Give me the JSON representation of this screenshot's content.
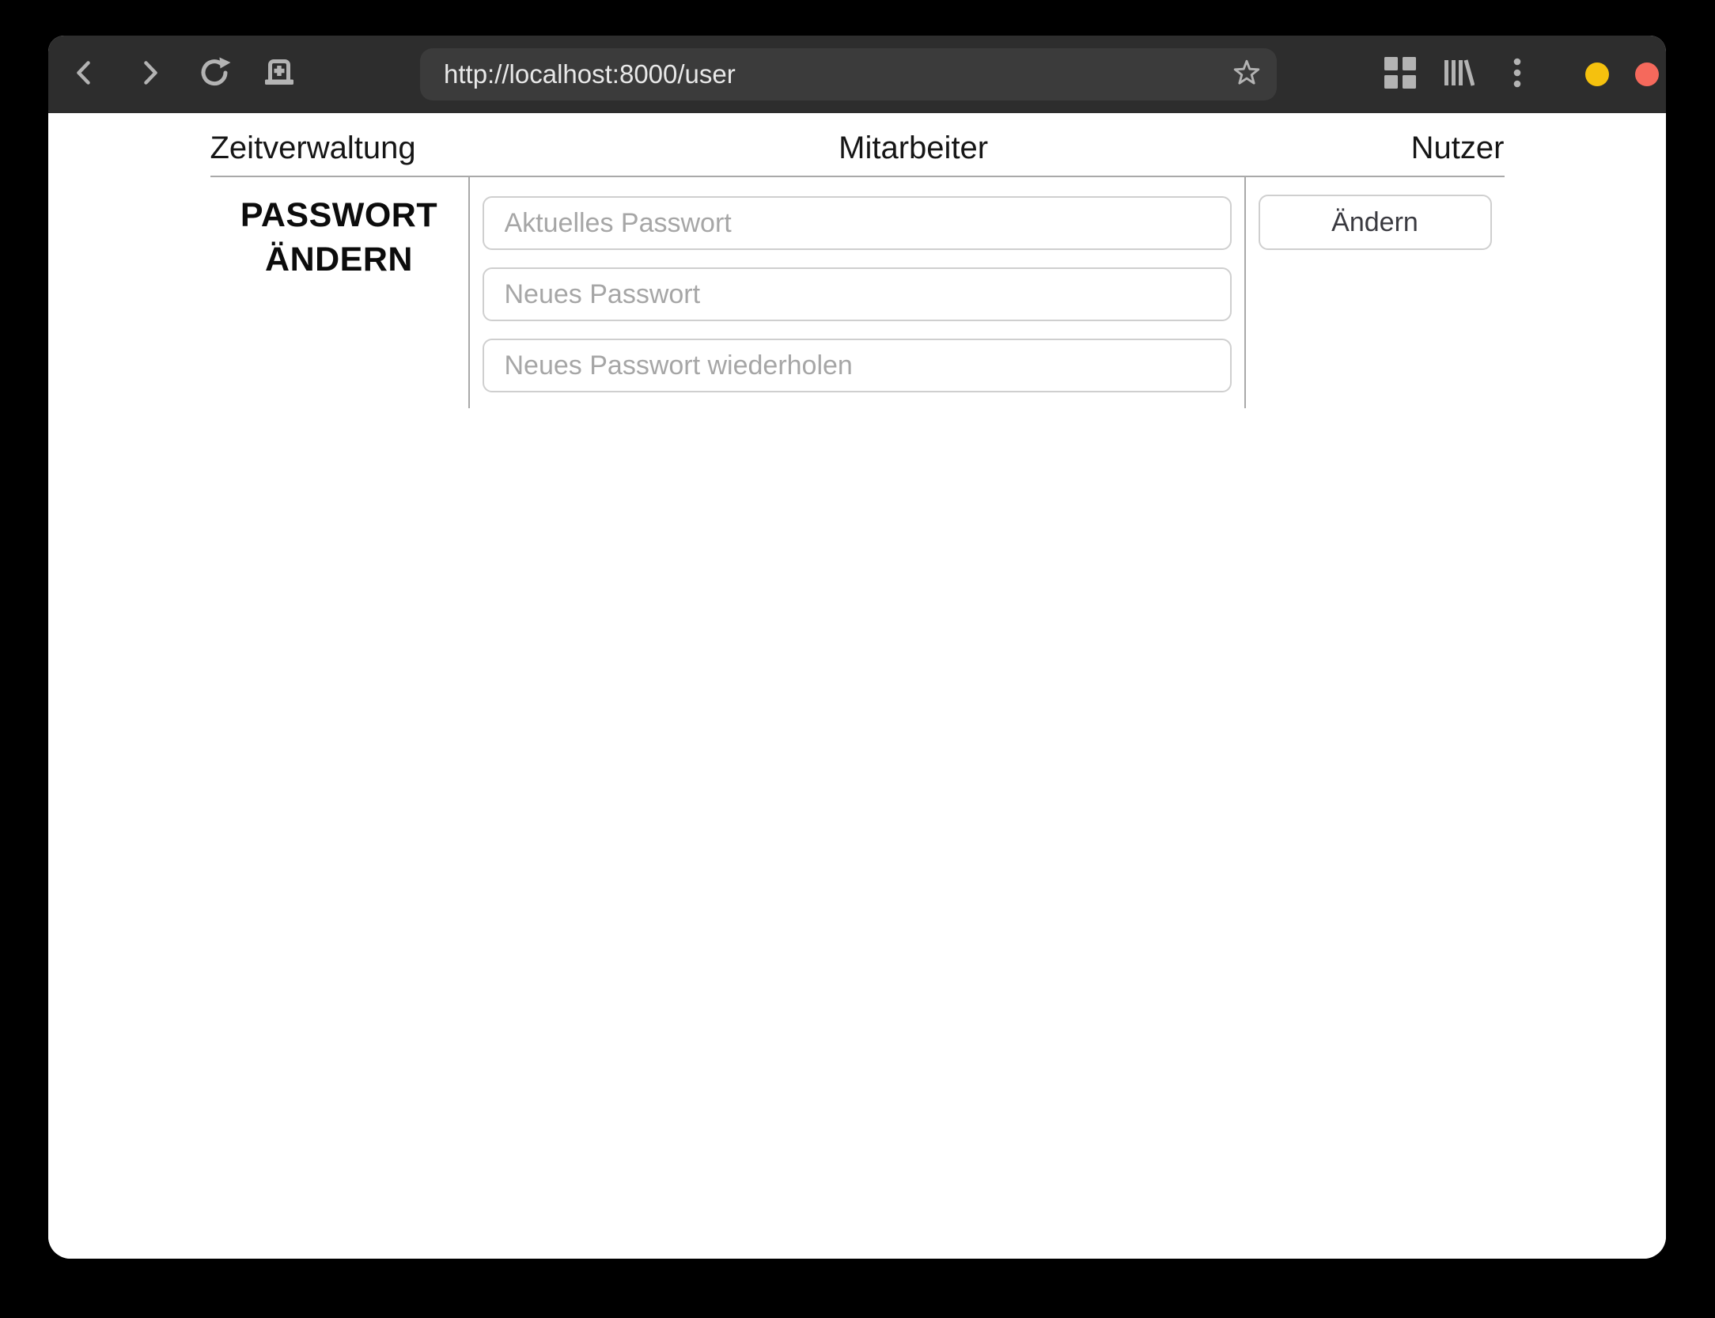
{
  "browser": {
    "url": "http://localhost:8000/user",
    "window_controls": {
      "minimize_color": "#f5c10e",
      "close_color": "#f5695c"
    }
  },
  "nav": {
    "items": [
      {
        "label": "Zeitverwaltung"
      },
      {
        "label": "Mitarbeiter"
      },
      {
        "label": "Nutzer"
      }
    ]
  },
  "password_form": {
    "heading": "PASSWORT ÄNDERN",
    "fields": [
      {
        "placeholder": "Aktuelles Passwort",
        "value": ""
      },
      {
        "placeholder": "Neues Passwort",
        "value": ""
      },
      {
        "placeholder": "Neues Passwort wiederholen",
        "value": ""
      }
    ],
    "submit_label": "Ändern"
  },
  "colors": {
    "titlebar_bg": "#2d2d2d",
    "addressbar_bg": "#3b3b3b",
    "page_bg": "#ffffff",
    "panel_divider": "#a9a9a9",
    "input_border": "#cfcfcf",
    "placeholder_text": "#a6a6a6"
  }
}
